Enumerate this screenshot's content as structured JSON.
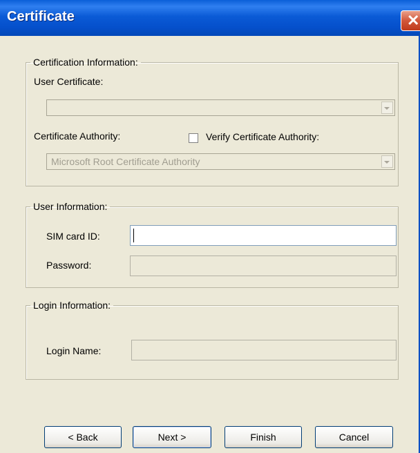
{
  "window": {
    "title": "Certificate",
    "close_glyph": "✕"
  },
  "certification": {
    "legend": "Certification Information:",
    "user_certificate_label": "User Certificate:",
    "user_certificate_value": "",
    "authority_label": "Certificate Authority:",
    "verify_label": "Verify Certificate Authority:",
    "verify_checked": false,
    "authority_value": "Microsoft Root Certificate Authority"
  },
  "user_info": {
    "legend": "User Information:",
    "sim_label": "SIM card ID:",
    "sim_value": "",
    "password_label": "Password:",
    "password_value": ""
  },
  "login_info": {
    "legend": "Login Information:",
    "login_name_label": "Login Name:",
    "login_name_value": ""
  },
  "buttons": {
    "back": "< Back",
    "next": "Next >",
    "finish": "Finish",
    "cancel": "Cancel"
  },
  "colors": {
    "titlebar": "#0a5fd8",
    "dialog_bg": "#ece9d8",
    "close": "#d2573a"
  }
}
